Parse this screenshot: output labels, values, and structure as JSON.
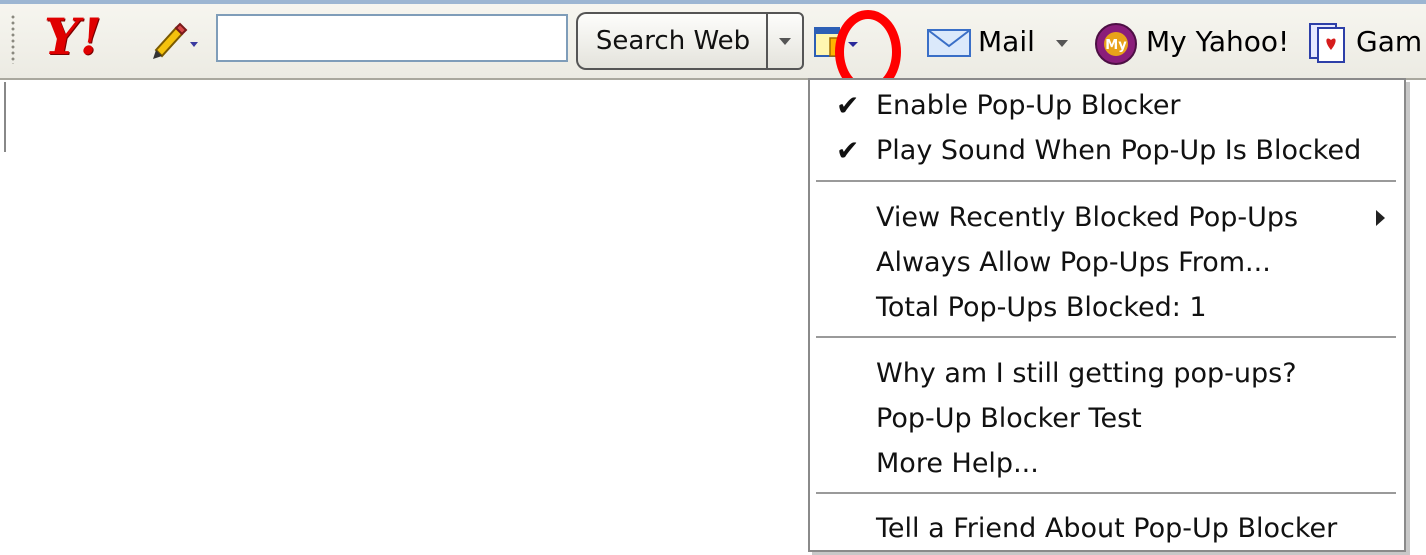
{
  "toolbar": {
    "logo": "Y!",
    "search_input": {
      "value": "",
      "placeholder": ""
    },
    "search_button_label": "Search Web",
    "mail_label": "Mail",
    "myyahoo_label": "My Yahoo!",
    "games_label": "Gam"
  },
  "icons": {
    "logo": "yahoo-logo",
    "pencil": "pencil-icon",
    "popup_blocker": "popup-blocker-icon",
    "mail": "envelope-icon",
    "myyahoo": "my-yahoo-icon",
    "games": "games-cards-icon"
  },
  "colors": {
    "yahoo_red": "#e00000",
    "highlight_circle": "#ff0000",
    "toolbar_bg": "#ecebe3"
  },
  "menu": {
    "items": [
      {
        "label": "Enable Pop-Up Blocker",
        "checked": true
      },
      {
        "label": "Play Sound When Pop-Up Is Blocked",
        "checked": true
      },
      {
        "label": "View Recently Blocked Pop-Ups",
        "submenu": true
      },
      {
        "label": "Always Allow Pop-Ups From..."
      },
      {
        "label": "Total Pop-Ups Blocked: 1"
      },
      {
        "label": "Why am I still getting pop-ups?"
      },
      {
        "label": "Pop-Up Blocker Test"
      },
      {
        "label": "More Help..."
      },
      {
        "label": "Tell a Friend About Pop-Up Blocker"
      }
    ],
    "check_glyph": "✔"
  }
}
